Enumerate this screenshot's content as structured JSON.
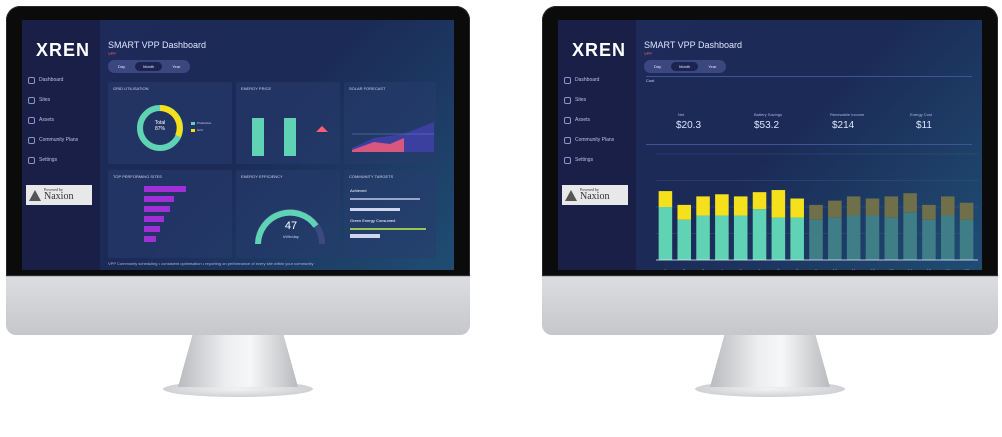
{
  "brand": "XREN",
  "sidebar_brand": {
    "partner_small": "Powered by",
    "partner_name": "Naxion"
  },
  "left_screen": {
    "title": "SMART VPP Dashboard",
    "subtitle": "VPP",
    "tabs": [
      "Day",
      "Month",
      "Year"
    ],
    "active_tab": 1,
    "nav": [
      "Dashboard",
      "Sites",
      "Assets",
      "Community Plans",
      "Settings"
    ],
    "cards": {
      "donut_title": "Grid Utilisation",
      "donut_center_label": "Total",
      "donut_center_value": "87%",
      "donut_legend": [
        "Production",
        "Grid"
      ],
      "bars_title": "Energy Price",
      "line_title": "Solar Forecast",
      "ranking_title": "Top Performing Sites",
      "gauge_title": "Energy Efficiency",
      "gauge_value": "47",
      "gauge_unit": "kWh/day",
      "target_title": "Community Targets",
      "target_labels": [
        "Achieved",
        "Green Energy Consumed"
      ]
    },
    "footer": "VPP Community scheduling • consistent optimisation • reporting on performance of every site within your community"
  },
  "right_screen": {
    "title": "SMART VPP Dashboard",
    "subtitle": "VPP",
    "tabs": [
      "Day",
      "Month",
      "Year"
    ],
    "active_tab": 1,
    "nav": [
      "Dashboard",
      "Sites",
      "Assets",
      "Community Plans",
      "Settings"
    ],
    "period_label": "Cost",
    "kpis": [
      {
        "label": "Net",
        "value": "$20.3"
      },
      {
        "label": "Battery Savings",
        "value": "$53.2"
      },
      {
        "label": "Renewable Income",
        "value": "$214"
      },
      {
        "label": "Energy Cost",
        "value": "$11"
      }
    ],
    "chart_data": {
      "type": "bar",
      "stacked": true,
      "ylim": [
        0,
        100
      ],
      "categories": [
        "1",
        "2",
        "3",
        "4",
        "5",
        "6",
        "7",
        "8",
        "9",
        "10",
        "11",
        "12",
        "13",
        "14",
        "15",
        "16",
        "17"
      ],
      "series": [
        {
          "name": "",
          "color": "#5fd3b4",
          "values": [
            50,
            38,
            42,
            42,
            42,
            48,
            40,
            40,
            38,
            40,
            42,
            42,
            40,
            45,
            38,
            42,
            38
          ]
        },
        {
          "name": "",
          "color": "#f5e11b",
          "values": [
            15,
            14,
            18,
            20,
            18,
            16,
            26,
            18,
            14,
            16,
            18,
            16,
            20,
            18,
            14,
            18,
            16
          ]
        }
      ]
    },
    "colors": {
      "bar_past_teal": "#5fd3b4",
      "bar_past_yellow": "#f5e11b",
      "bar_future_teal": "#3f7d87",
      "bar_future_olive": "#6f6f4a"
    }
  }
}
